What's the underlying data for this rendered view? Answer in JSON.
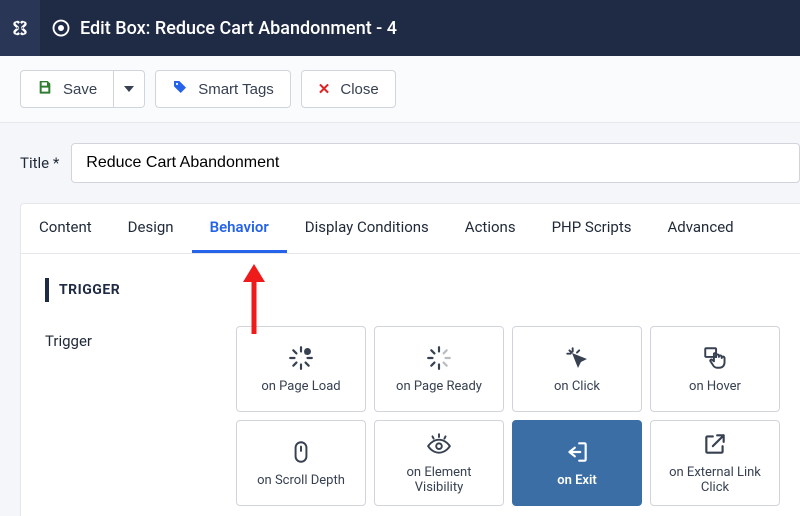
{
  "header": {
    "page_title": "Edit Box: Reduce Cart Abandonment - 4"
  },
  "toolbar": {
    "save_label": "Save",
    "smart_tags_label": "Smart Tags",
    "close_label": "Close"
  },
  "form": {
    "title_label": "Title *",
    "title_value": "Reduce Cart Abandonment"
  },
  "tabs": [
    {
      "label": "Content",
      "active": false
    },
    {
      "label": "Design",
      "active": false
    },
    {
      "label": "Behavior",
      "active": true
    },
    {
      "label": "Display Conditions",
      "active": false
    },
    {
      "label": "Actions",
      "active": false
    },
    {
      "label": "PHP Scripts",
      "active": false
    },
    {
      "label": "Advanced",
      "active": false
    }
  ],
  "panel": {
    "section_label": "TRIGGER",
    "trigger_label": "Trigger",
    "options": [
      {
        "label": "on Page Load",
        "icon": "spinner-dot-icon",
        "active": false
      },
      {
        "label": "on Page Ready",
        "icon": "spinner-icon",
        "active": false
      },
      {
        "label": "on Click",
        "icon": "cursor-click-icon",
        "active": false
      },
      {
        "label": "on Hover",
        "icon": "hand-hover-icon",
        "active": false
      },
      {
        "label": "on Scroll Depth",
        "icon": "mouse-icon",
        "active": false
      },
      {
        "label": "on Element Visibility",
        "icon": "eye-icon",
        "active": false
      },
      {
        "label": "on Exit",
        "icon": "exit-icon",
        "active": true
      },
      {
        "label": "on External Link Click",
        "icon": "external-link-icon",
        "active": false
      }
    ]
  },
  "annotation": {
    "arrow_target": "tab-behavior"
  }
}
